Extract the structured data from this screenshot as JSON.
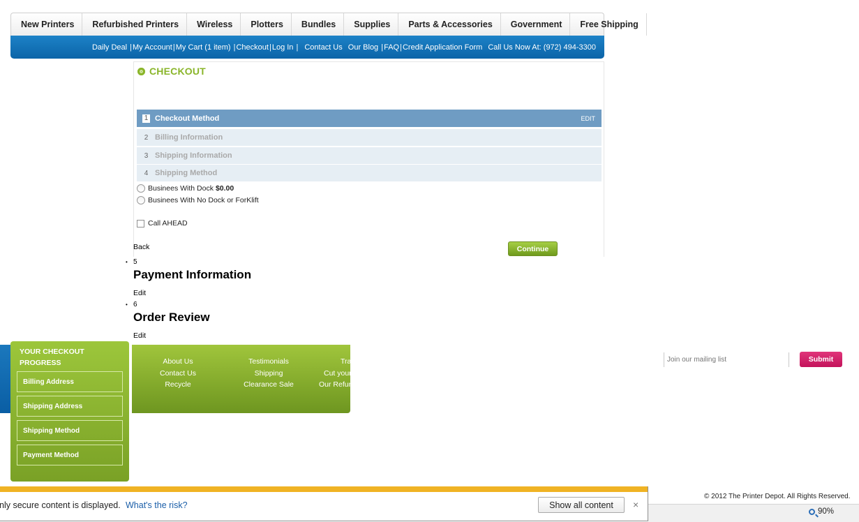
{
  "nav": {
    "items": [
      "New Printers",
      "Refurbished Printers",
      "Wireless",
      "Plotters",
      "Bundles",
      "Supplies",
      "Parts & Accessories",
      "Government",
      "Free Shipping"
    ]
  },
  "subbar": {
    "daily_deal": "Daily Deal",
    "my_account": "My Account",
    "my_cart": "My Cart (1 item)",
    "checkout": "Checkout",
    "log_in": "Log In",
    "contact_us": "Contact Us",
    "our_blog": "Our Blog",
    "faq": "FAQ",
    "credit_app": "Credit Application Form",
    "call_us": "Call Us Now At: (972) 494-3300"
  },
  "checkout": {
    "title": "CHECKOUT",
    "steps": [
      {
        "num": "1",
        "label": "Checkout Method",
        "edit": "EDIT"
      },
      {
        "num": "2",
        "label": "Billing Information"
      },
      {
        "num": "3",
        "label": "Shipping Information"
      },
      {
        "num": "4",
        "label": "Shipping Method"
      }
    ],
    "options": [
      {
        "label": "Businees With Dock",
        "price": "$0.00"
      },
      {
        "label": "Businees With No Dock or ForKlift"
      }
    ],
    "call_ahead": "Call AHEAD",
    "back": "Back",
    "continue": "Continue"
  },
  "sections": [
    {
      "num": "5",
      "title": "Payment Information",
      "edit": "Edit"
    },
    {
      "num": "6",
      "title": "Order Review",
      "edit": "Edit"
    }
  ],
  "footer": {
    "col1": [
      "About Us",
      "Contact Us",
      "Recycle"
    ],
    "col2": [
      "Testimonials",
      "Shipping",
      "Clearance Sale"
    ],
    "col3": [
      "Tra",
      "Cut your",
      "Our Refun"
    ],
    "mail_placeholder": "Join our mailing list",
    "submit": "Submit",
    "copyright": "© 2012 The Printer Depot. All Rights Reserved."
  },
  "progress": {
    "title": "YOUR CHECKOUT PROGRESS",
    "items": [
      "Billing Address",
      "Shipping Address",
      "Shipping Method",
      "Payment Method"
    ]
  },
  "ie": {
    "message": "nly secure content is displayed.",
    "risk": "What's the risk?",
    "show_all": "Show all content",
    "close": "×",
    "zoom": "90%"
  }
}
